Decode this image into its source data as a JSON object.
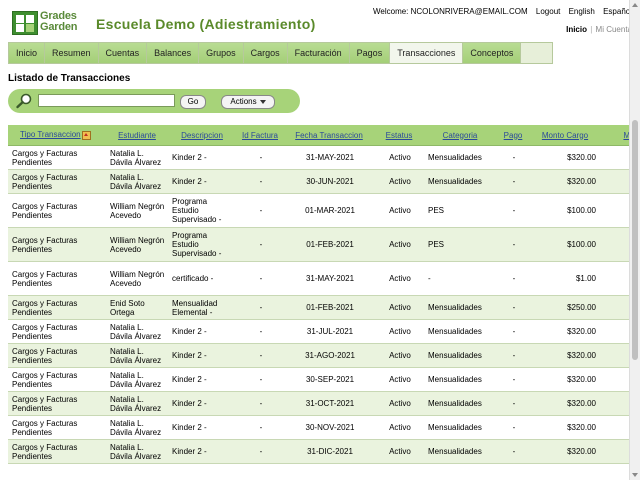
{
  "header": {
    "logo_text_1": "Grades",
    "logo_text_2": "Garden",
    "school_title": "Escuela Demo (Adiestramiento)",
    "welcome": "Welcome: NCOLONRIVERA@EMAIL.COM",
    "logout": "Logout",
    "english": "English",
    "espanol": "Español",
    "inicio": "Inicio",
    "sep": "|",
    "mi_cuenta": "Mi Cuenta"
  },
  "nav": {
    "items": [
      "Inicio",
      "Resumen",
      "Cuentas",
      "Balances",
      "Grupos",
      "Cargos",
      "Facturación",
      "Pagos",
      "Transacciones",
      "Conceptos"
    ],
    "active": "Transacciones"
  },
  "page": {
    "list_title": "Listado de Transacciones",
    "search_value": "",
    "go_label": "Go",
    "actions_label": "Actions"
  },
  "table": {
    "columns": [
      "Tipo Transaccion",
      "Estudiante",
      "Descripcion",
      "Id Factura",
      "Fecha Transaccion",
      "Estatus",
      "Categoria",
      "Pago",
      "Monto Cargo",
      "Mo"
    ],
    "rows": [
      [
        "Cargos y Facturas Pendientes",
        "Natalia L. Dávila Álvarez",
        "Kinder 2 -",
        "-",
        "31-MAY-2021",
        "Activo",
        "Mensualidades",
        "-",
        "$320.00"
      ],
      [
        "Cargos y Facturas Pendientes",
        "Natalia L. Dávila Álvarez",
        "Kinder 2 -",
        "-",
        "30-JUN-2021",
        "Activo",
        "Mensualidades",
        "-",
        "$320.00"
      ],
      [
        "Cargos y Facturas Pendientes",
        "William Negrón Acevedo",
        "Programa Estudio Supervisado -",
        "-",
        "01-MAR-2021",
        "Activo",
        "PES",
        "-",
        "$100.00"
      ],
      [
        "Cargos y Facturas Pendientes",
        "William Negrón Acevedo",
        "Programa Estudio Supervisado -",
        "-",
        "01-FEB-2021",
        "Activo",
        "PES",
        "-",
        "$100.00"
      ],
      [
        "Cargos y Facturas Pendientes",
        "William Negrón Acevedo",
        "certificado -",
        "-",
        "31-MAY-2021",
        "Activo",
        "-",
        "-",
        "$1.00"
      ],
      [
        "Cargos y Facturas Pendientes",
        "Enid Soto Ortega",
        "Mensualidad Elemental -",
        "-",
        "01-FEB-2021",
        "Activo",
        "Mensualidades",
        "-",
        "$250.00"
      ],
      [
        "Cargos y Facturas Pendientes",
        "Natalia L. Dávila Álvarez",
        "Kinder 2 -",
        "-",
        "31-JUL-2021",
        "Activo",
        "Mensualidades",
        "-",
        "$320.00"
      ],
      [
        "Cargos y Facturas Pendientes",
        "Natalia L. Dávila Álvarez",
        "Kinder 2 -",
        "-",
        "31-AGO-2021",
        "Activo",
        "Mensualidades",
        "-",
        "$320.00"
      ],
      [
        "Cargos y Facturas Pendientes",
        "Natalia L. Dávila Álvarez",
        "Kinder 2 -",
        "-",
        "30-SEP-2021",
        "Activo",
        "Mensualidades",
        "-",
        "$320.00"
      ],
      [
        "Cargos y Facturas Pendientes",
        "Natalia L. Dávila Álvarez",
        "Kinder 2 -",
        "-",
        "31-OCT-2021",
        "Activo",
        "Mensualidades",
        "-",
        "$320.00"
      ],
      [
        "Cargos y Facturas Pendientes",
        "Natalia L. Dávila Álvarez",
        "Kinder 2 -",
        "-",
        "30-NOV-2021",
        "Activo",
        "Mensualidades",
        "-",
        "$320.00"
      ],
      [
        "Cargos y Facturas Pendientes",
        "Natalia L. Dávila Álvarez",
        "Kinder 2 -",
        "-",
        "31-DIC-2021",
        "Activo",
        "Mensualidades",
        "-",
        "$320.00"
      ]
    ]
  },
  "colors": {
    "brand_green": "#5a8a2a",
    "nav_green": "#a4cf78",
    "row_alt": "#eaf3de",
    "header_link": "#2a4a9a"
  }
}
